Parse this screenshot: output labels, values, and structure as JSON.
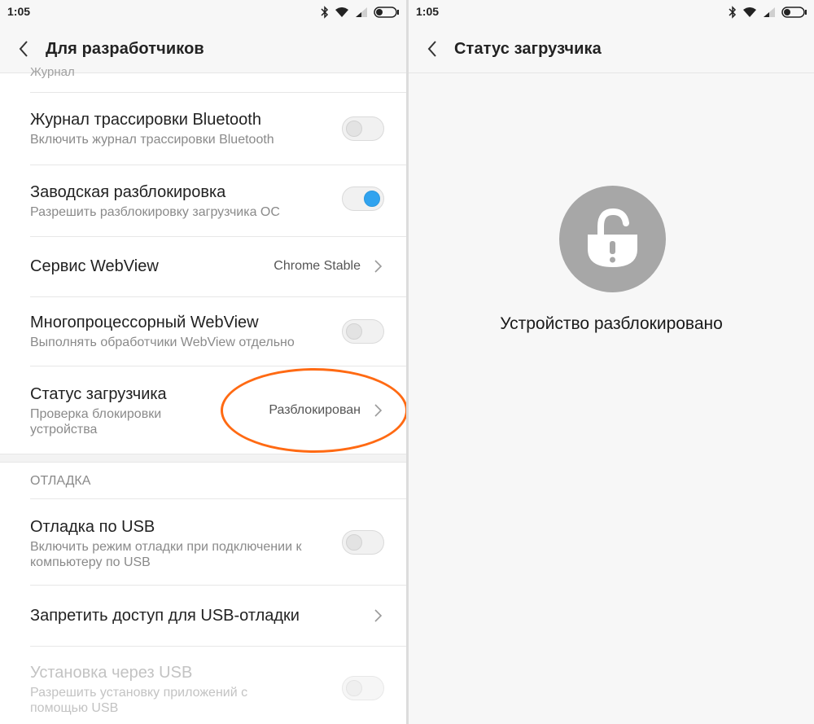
{
  "status_bar": {
    "time": "1:05"
  },
  "left_screen": {
    "title": "Для разработчиков",
    "clipped_section_label": "Журнал",
    "items": [
      {
        "title": "Журнал трассировки Bluetooth",
        "subtitle": "Включить журнал трассировки Bluetooth",
        "toggle": false
      },
      {
        "title": "Заводская разблокировка",
        "subtitle": "Разрешить разблокировку загрузчика ОС",
        "toggle": true
      },
      {
        "title": "Сервис WebView",
        "value": "Chrome Stable"
      },
      {
        "title": "Многопроцессорный WebView",
        "subtitle": "Выполнять обработчики WebView отдельно",
        "toggle": false
      },
      {
        "title": "Статус загрузчика",
        "subtitle_line1": "Проверка блокировки",
        "subtitle_line2": "устройства",
        "value": "Разблокирован"
      }
    ],
    "section_debug": "ОТЛАДКА",
    "debug_items": [
      {
        "title": "Отладка по USB",
        "subtitle_line1": "Включить режим отладки при подключении к",
        "subtitle_line2": "компьютеру по USB",
        "toggle": false
      },
      {
        "title": "Запретить доступ для USB-отладки"
      },
      {
        "title": "Установка через USB",
        "subtitle_line1": "Разрешить установку приложений с",
        "subtitle_line2": "помощью USB",
        "toggle": false,
        "disabled": true
      }
    ]
  },
  "right_screen": {
    "title": "Статус загрузчика",
    "status_text": "Устройство разблокировано"
  },
  "colors": {
    "accent_toggle": "#30a3ef",
    "highlight": "#ff6a13",
    "lock_circle": "#a7a7a7"
  },
  "icons": [
    "back-arrow-icon",
    "chevron-right-icon",
    "bluetooth-icon",
    "wifi-icon",
    "signal-icon",
    "battery-icon",
    "unlocked-padlock-icon"
  ]
}
